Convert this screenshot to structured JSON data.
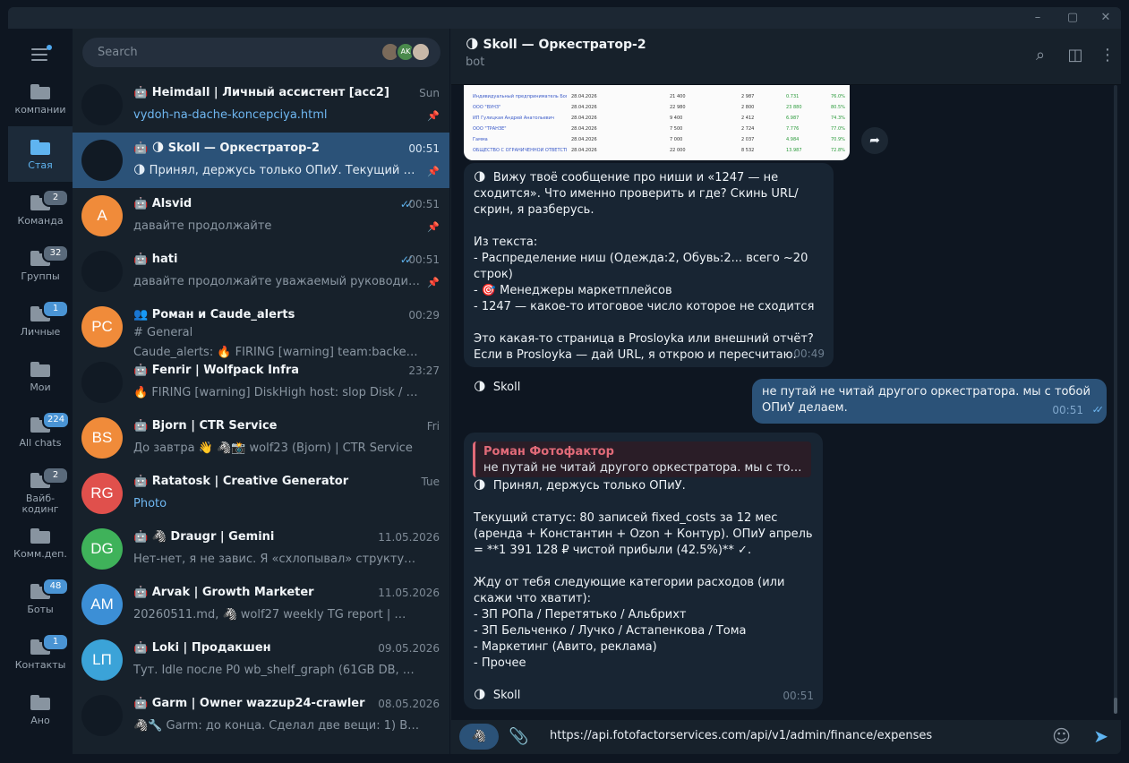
{
  "search": {
    "placeholder": "Search"
  },
  "search_avatars": [
    "",
    "AK",
    ""
  ],
  "folders": [
    {
      "label": "компании",
      "badge": ""
    },
    {
      "label": "Стая",
      "badge": ""
    },
    {
      "label": "Команда",
      "badge": "2"
    },
    {
      "label": "Группы",
      "badge": "32"
    },
    {
      "label": "Личные",
      "badge": "1"
    },
    {
      "label": "Мои",
      "badge": ""
    },
    {
      "label": "All chats",
      "badge": "224"
    },
    {
      "label": "Вайб-\nкодинг",
      "badge": "2"
    },
    {
      "label": "Комм.деп.",
      "badge": ""
    },
    {
      "label": "Боты",
      "badge": "48"
    },
    {
      "label": "Контакты",
      "badge": "1"
    },
    {
      "label": "Ано",
      "badge": ""
    }
  ],
  "chats": [
    {
      "name": "Heimdall | Личный ассистент [acc2]",
      "time": "Sun",
      "preview": "vydoh-na-dache-koncepciya.html",
      "avatar": "",
      "color": "#111a24"
    },
    {
      "name": "🌗 Skoll — Оркестратор-2",
      "time": "00:51",
      "preview": "🌗 Принял, держусь только ОПиУ.  Текущий ста...",
      "avatar": "",
      "color": "#111a24"
    },
    {
      "name": "Alsvid",
      "time": "00:51",
      "preview": "давайте продолжайте",
      "avatar": "A",
      "color": "#f08b3a"
    },
    {
      "name": "hati",
      "time": "00:51",
      "preview": "давайте продолжайте уважаемый руководитель...",
      "avatar": "",
      "color": "#111a24"
    },
    {
      "name": "Роман и Caude_alerts",
      "time": "00:29",
      "sub": "# General",
      "preview": "Caude_alerts: 🔥 FIRING [warning] team:backend  RQ...",
      "avatar": "PC",
      "color": "#f08b3a"
    },
    {
      "name": "Fenrir | Wolfpack Infra",
      "time": "23:27",
      "preview": "🔥 FIRING [warning]  DiskHigh host: slop Disk / on slo...",
      "avatar": "",
      "color": "#111a24"
    },
    {
      "name": "Bjorn | CTR Service",
      "time": "Fri",
      "preview": "До завтра 👋 🦓📸 wolf23 (Bjorn) | CTR Service",
      "avatar": "BS",
      "color": "#f08b3a"
    },
    {
      "name": "Ratatosk | Creative Generator",
      "time": "Tue",
      "preview": "Photo",
      "avatar": "RG",
      "color": "#e0504c"
    },
    {
      "name": "🦓 Draugr | Gemini",
      "time": "11.05.2026",
      "preview": "Нет-нет, я не завис. Я «схлопывал» структуру в голов...",
      "avatar": "DG",
      "color": "#3fb25a"
    },
    {
      "name": "Arvak | Growth Marketer",
      "time": "11.05.2026",
      "preview": "20260511.md, 🦓 wolf27 weekly TG report | 📝 252 п...",
      "avatar": "AM",
      "color": "#3c8fd6"
    },
    {
      "name": "Loki | Продакшен",
      "time": "09.05.2026",
      "preview": "Тут. Idle после P0 wb_shelf_graph (61GB DB, +32.7GB ...",
      "avatar": "LП",
      "color": "#3ba3d8"
    },
    {
      "name": "Garm | Owner wazzup24-crawler",
      "time": "08.05.2026",
      "preview": "🦓🔧 Garm: до конца. Сделал две вещи:  1) В env ap...",
      "avatar": "",
      "color": "#111a24"
    }
  ],
  "header": {
    "title": "Skoll — Оркестратор-2",
    "subtitle": "bot"
  },
  "messages": [
    {
      "text": "🌗  Вижу твоё сообщение про ниши и «1247 — не сходится». Что именно проверить и где? Скинь URL/скрин, я разберусь.\n\nИз текста:\n- Распределение ниш (Одежда:2, Обувь:2... всего ~20 строк)\n- 🎯 Менеджеры маркетплейсов\n- 1247 — какое-то итоговое число которое не сходится\n\nЭто какая-то страница в Prosloyka или внешний отчёт? Если в Prosloyka — дай URL, я открою и пересчитаю.\n\n🌗  Skoll",
      "time": "00:49"
    },
    {
      "text": "не путай не читай другого оркестратора. мы с тобой ОПиУ делаем.",
      "time": "00:51"
    },
    {
      "reply_name": "Роман Фотофактор",
      "reply_text": "не путай не читай другого оркестратора. мы с тобой О...",
      "text": "🌗  Принял, держусь только ОПиУ.\n\nТекущий статус: 80 записей fixed_costs за 12 мес (аренда + Константин + Ozon + Контур). ОПиУ апрель = **1 391 128 ₽ чистой прибыли (42.5%)** ✓.\n\nЖду от тебя следующие категории расходов (или скажи что хватит):\n- ЗП РОПа / Перетятько / Альбрихт\n- ЗП Бельченко / Лучко / Астапенкова / Тома\n- Маркетинг (Авито, реклама)\n- Прочее\n\n🌗  Skoll",
      "time": "00:51"
    }
  ],
  "composer": {
    "text": "https://api.fotofactorservices.com/api/v1/admin/finance/expenses"
  },
  "screenshot": {
    "rows": [
      [
        "Индивидуальный предприниматель Богданова Анна Павловна",
        "28.04.2026",
        "21 400",
        "2 987",
        "0.731",
        "76.0%"
      ],
      [
        "ООО \"ВУНЗ\"",
        "28.04.2026",
        "22 980",
        "2 800",
        "23 880",
        "80.5%"
      ],
      [
        "ИП Гулицкая Андрей Анатольевич",
        "28.04.2026",
        "9 400",
        "2 412",
        "6.987",
        "74.3%"
      ],
      [
        "ООО \"ТРАНЗЕ\"",
        "28.04.2026",
        "7 500",
        "2 724",
        "7.776",
        "77.0%"
      ],
      [
        "Гамма",
        "28.04.2026",
        "7 000",
        "2 037",
        "4.984",
        "70.9%"
      ],
      [
        "ОБЩЕСТВО С ОГРАНИЧЕННОЙ ОТВЕТСТВЕННОСТЬЮ \"ЛАБОРАТОРИЯ МАРКЕТИНГА\"",
        "28.04.2026",
        "22 000",
        "8 532",
        "13.987",
        "72.8%"
      ]
    ]
  }
}
